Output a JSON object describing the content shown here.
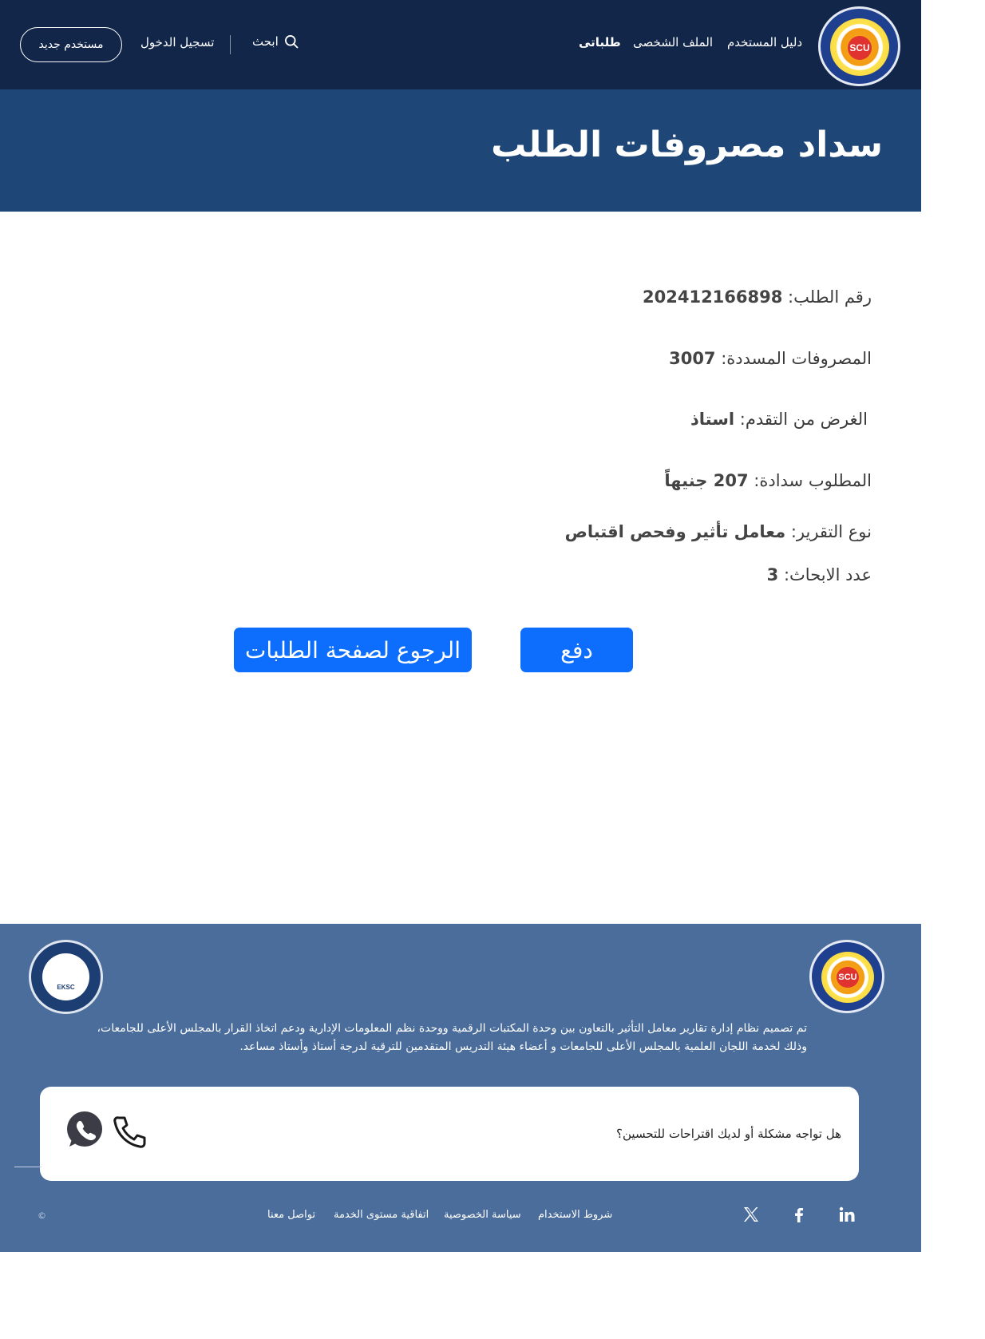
{
  "header": {
    "logo_text": "SCU",
    "nav": [
      {
        "label": "دليل المستخدم"
      },
      {
        "label": "الملف الشخصى"
      },
      {
        "label": "طلباتى"
      }
    ],
    "search_label": "ابحث",
    "login_label": "تسجيل الدخول",
    "new_user_label": "مستخدم جديد"
  },
  "hero": {
    "title": "سداد مصروفات الطلب"
  },
  "details": {
    "order_number_label": "رقم الطلب:",
    "order_number_value": "202412166898",
    "paid_fees_label": "المصروفات المسددة:",
    "paid_fees_value": "3007",
    "purpose_label": "الغرض من التقدم:",
    "purpose_value": "استاذ",
    "required_label": "المطلوب سدادة:",
    "required_value": "207 جنيهاً",
    "report_type_label": "نوع التقرير:",
    "report_type_value": "معامل تأثير وفحص اقتباص",
    "research_count_label": "عدد الابحاث:",
    "research_count_value": "3"
  },
  "actions": {
    "pay_label": "دفع",
    "back_label": "الرجوع لصفحة الطلبات"
  },
  "footer": {
    "right_logo_text": "SCU",
    "left_logo_text": "EKSC",
    "description_line1": "تم تصميم نظام إدارة تقارير معامل التأثير بالتعاون بين وحدة المكتبات الرقمية ووحدة نظم المعلومات الإدارية ودعم اتخاذ القرار بالمجلس الأعلى للجامعات،",
    "description_line2": "وذلك لخدمة اللجان العلمية بالمجلس الأعلى للجامعات و أعضاء هيئة التدريس المتقدمين للترقية لدرجة أستاذ وأستاذ مساعد.",
    "contact_question": "هل تواجه مشكلة أو لديك اقتراحات للتحسين؟",
    "links": [
      {
        "label": "شروط الاستخدام"
      },
      {
        "label": "سياسة الخصوصية"
      },
      {
        "label": "اتفاقية مستوى الخدمة"
      },
      {
        "label": "تواصل معنا"
      }
    ],
    "copyright": "©"
  },
  "colors": {
    "header_bg": "#12264a",
    "hero_bg": "#1e4676",
    "footer_bg": "#4a6d9c",
    "button_bg": "#0d6efd"
  }
}
